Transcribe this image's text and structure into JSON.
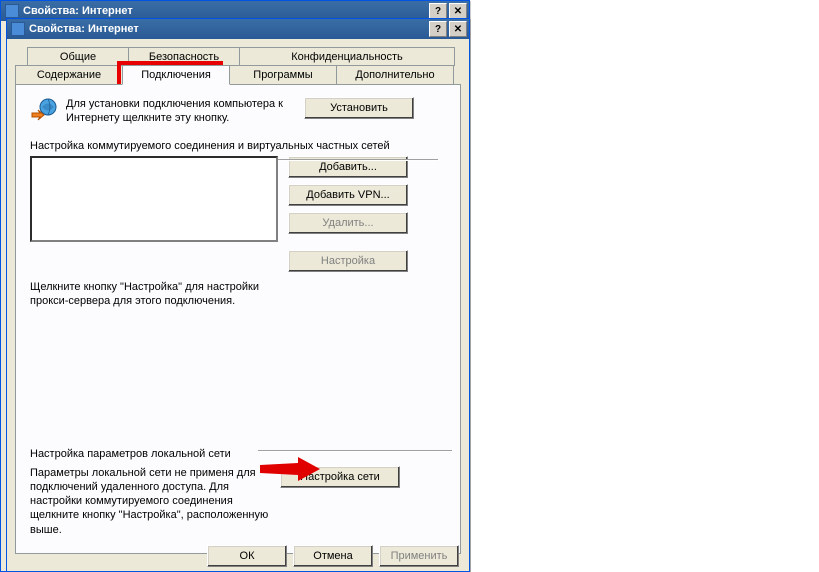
{
  "window_back": {
    "title": "Свойства: Интернет"
  },
  "window_front": {
    "title": "Свойства: Интернет"
  },
  "tabs": {
    "row1": [
      "Общие",
      "Безопасность",
      "Конфиденциальность"
    ],
    "row2": [
      "Содержание",
      "Подключения",
      "Программы",
      "Дополнительно"
    ]
  },
  "setup": {
    "text": "Для установки подключения компьютера к Интернету щелкните эту кнопку.",
    "button": "Установить"
  },
  "dial": {
    "label": "Настройка коммутируемого соединения и виртуальных частных сетей",
    "add": "Добавить...",
    "addvpn": "Добавить VPN...",
    "remove": "Удалить...",
    "settings": "Настройка",
    "hint": "Щелкните кнопку \"Настройка\" для настройки прокси-сервера для этого подключения."
  },
  "lan": {
    "label": "Настройка параметров локальной сети",
    "text": "Параметры локальной сети не применя для подключений удаленного доступа. Для настройки коммутируемого соединения щелкните кнопку \"Настройка\", расположенную выше.",
    "button": "Настройка сети"
  },
  "dlg": {
    "ok": "ОК",
    "cancel": "Отмена",
    "apply": "Применить"
  },
  "titlebar_help": "?",
  "titlebar_close": "✕"
}
